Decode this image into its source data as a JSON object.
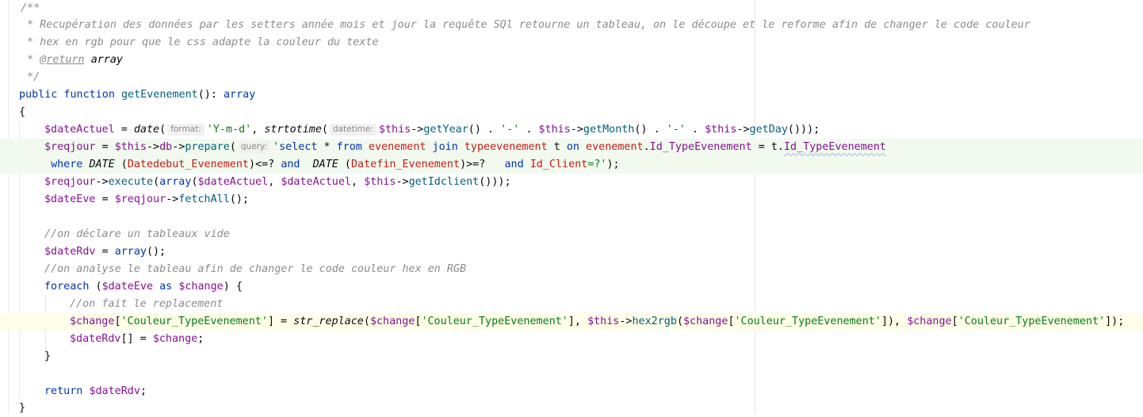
{
  "code": {
    "doc_open": "/**",
    "doc_line1": " * Recupération des données par les setters année mois et jour la requête SQl retourne un tableau, on le découpe et le reforme afin de changer le code couleur",
    "doc_line2": " * hex en rgb pour que le css adapte la couleur du texte",
    "doc_star": " * ",
    "doc_return_tag": "@return",
    "doc_return_type": "array",
    "doc_close": " */",
    "kw_public": "public",
    "kw_function": "function",
    "fn_name": "getEvenement",
    "sig_rest": "(): ",
    "kw_array": "array",
    "brace_open": "{",
    "brace_close": "}",
    "var_dateActuel": "$dateActuel",
    "var_this": "$this",
    "var_reqjour": "$reqjour",
    "var_dateEve": "$dateEve",
    "var_dateRdv": "$dateRdv",
    "var_change": "$change",
    "fn_date": "date",
    "fn_strtotime": "strtotime",
    "fn_str_replace": "str_replace",
    "meth_getYear": "getYear",
    "meth_getMonth": "getMonth",
    "meth_getDay": "getDay",
    "meth_db": "db",
    "meth_prepare": "prepare",
    "meth_execute": "execute",
    "meth_getIdclient": "getIdclient",
    "meth_fetchAll": "fetchAll",
    "meth_hex2rgb": "hex2rgb",
    "hint_format": "format:",
    "hint_datetime": "datetime:",
    "hint_query": "query:",
    "str_format": "'Y-m-d'",
    "str_dash": "'-'",
    "str_key": "'Couleur_TypeEvenement'",
    "sql": {
      "q": "'",
      "select": "select",
      "star": " * ",
      "from": "from",
      "t_evenement": "evenement",
      "join": "join",
      "t_typeevenement": "typeevenement",
      "alias": " t ",
      "on": "on",
      "c_id_type": "Id_TypeEvenement",
      "eq": " = t.",
      "indent": "     ",
      "where": "where",
      "fn_date": "DATE",
      "c_datedebut": "Datedebut_Evenement",
      "op_le": ")<=? ",
      "and": "and",
      "c_datefin": "Datefin_Evenement",
      "op_ge": ")>=?   ",
      "c_idclient": "Id_Client",
      "tail": "=?'"
    },
    "cmt_vide": "//on déclare un tableaux vide",
    "cmt_analyse": "//on analyse le tableau afin de changer le code couleur hex en RGB",
    "cmt_replace": "//on fait le replacement",
    "kw_foreach": "foreach",
    "kw_as": "as",
    "kw_return": "return"
  }
}
